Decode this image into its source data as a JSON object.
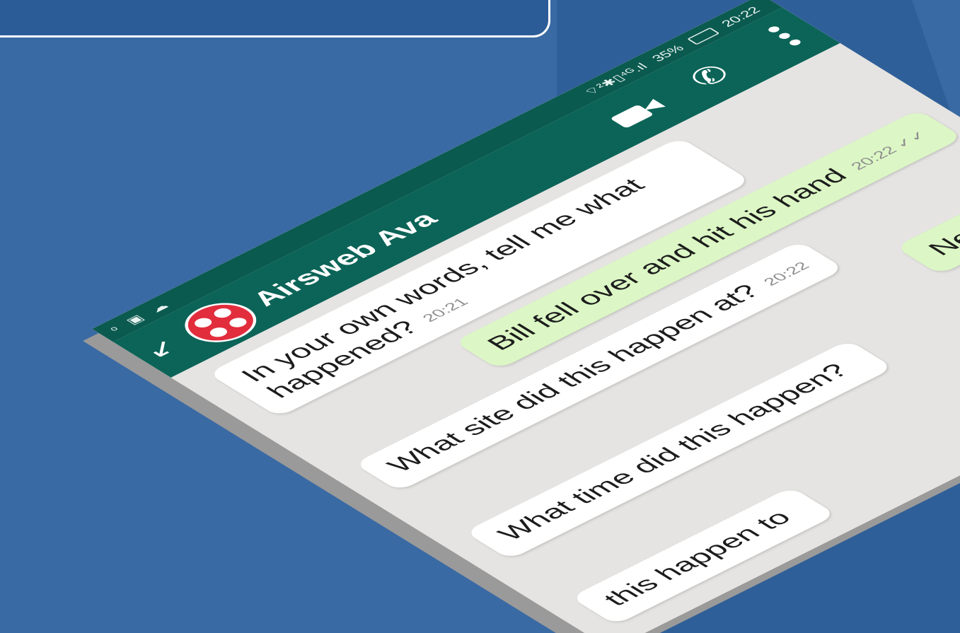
{
  "statusbar": {
    "left_icons": "ᵒ ▣ ☁",
    "signal_icons": "⌔²✱▯⁴ᴳ.ıl",
    "battery_level": "35%",
    "time": "20:22"
  },
  "header": {
    "back_glyph": "↙",
    "contact_name": "Airsweb Ava",
    "avatar_color": "#e22d3d",
    "call_glyph": "✆"
  },
  "messages": [
    {
      "direction": "in",
      "text": "In your own words, tell me what happened?",
      "time": "20:21"
    },
    {
      "direction": "out",
      "text": "Bill fell over and hit his hand",
      "time": "20:22 ✓✓"
    },
    {
      "direction": "in",
      "text": "What site did this happen at?",
      "time": "20:22"
    },
    {
      "direction": "out",
      "text": "New Yo",
      "time": ""
    },
    {
      "direction": "in",
      "text": "What time did this happen?",
      "time": ""
    },
    {
      "direction": "in",
      "text": "this happen to",
      "time": ""
    }
  ],
  "colors": {
    "background": "#3a6aa4",
    "statusbar": "#0b5a4f",
    "appbar": "#0b6457",
    "chat_background": "#e5e4e2",
    "incoming_bubble": "#ffffff",
    "outgoing_bubble": "#dcf7c5"
  }
}
